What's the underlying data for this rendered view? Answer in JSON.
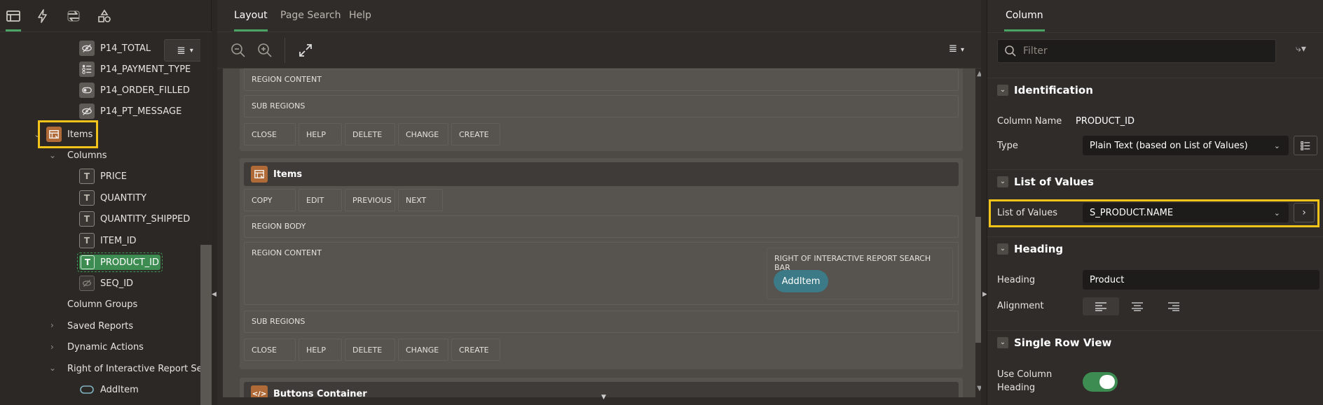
{
  "left_panel": {
    "tabs": [
      "rendering-tab",
      "dynamic-actions-tab",
      "processing-tab",
      "shared-components-tab"
    ],
    "tree": {
      "items_above": [
        {
          "label": "P14_TOTAL",
          "icon": "hidden-item-icon"
        },
        {
          "label": "P14_PAYMENT_TYPE",
          "icon": "radio-group-icon"
        },
        {
          "label": "P14_ORDER_FILLED",
          "icon": "switch-item-icon"
        },
        {
          "label": "P14_PT_MESSAGE",
          "icon": "hidden-item-icon"
        }
      ],
      "region": {
        "label": "Items"
      },
      "columns_group": {
        "label": "Columns"
      },
      "columns": [
        {
          "label": "PRICE"
        },
        {
          "label": "QUANTITY"
        },
        {
          "label": "QUANTITY_SHIPPED"
        },
        {
          "label": "ITEM_ID"
        },
        {
          "label": "PRODUCT_ID"
        },
        {
          "label": "SEQ_ID"
        }
      ],
      "column_groups": "Column Groups",
      "saved_reports": "Saved Reports",
      "dynamic_actions": "Dynamic Actions",
      "right_of_ir": "Right of Interactive Report Search",
      "add_item": "AddItem"
    }
  },
  "center_panel": {
    "tabs": [
      "Layout",
      "Page Search",
      "Help"
    ],
    "active_tab": "Layout",
    "top_region": {
      "region_content": "REGION CONTENT",
      "sub_regions": "SUB REGIONS",
      "buttons": [
        "CLOSE",
        "HELP",
        "DELETE",
        "CHANGE",
        "CREATE"
      ]
    },
    "items_region": {
      "title": "Items",
      "top_buttons": [
        "COPY",
        "EDIT",
        "PREVIOUS",
        "NEXT"
      ],
      "region_body": "REGION BODY",
      "region_content": "REGION CONTENT",
      "right_of_search": "RIGHT OF INTERACTIVE REPORT SEARCH BAR",
      "add_item_button": "AddItem",
      "sub_regions": "SUB REGIONS",
      "bottom_buttons": [
        "CLOSE",
        "HELP",
        "DELETE",
        "CHANGE",
        "CREATE"
      ]
    },
    "next_region_partial": "Buttons Container"
  },
  "right_panel": {
    "tab": "Column",
    "filter_placeholder": "Filter",
    "sections": {
      "identification": "Identification",
      "list_of_values": "List of Values",
      "heading": "Heading",
      "single_row_view": "Single Row View"
    },
    "props": {
      "column_name_label": "Column Name",
      "column_name_value": "PRODUCT_ID",
      "type_label": "Type",
      "type_value": "Plain Text (based on List of Values)",
      "lov_label": "List of Values",
      "lov_value": "S_PRODUCT.NAME",
      "heading_label": "Heading",
      "heading_value": "Product",
      "alignment_label": "Alignment",
      "use_col_heading_label_1": "Use Column",
      "use_col_heading_label_2": "Heading",
      "use_col_heading_value": true
    }
  },
  "colors": {
    "accent_green": "#4aa564",
    "highlight_yellow": "#f2c318",
    "region_icon": "#b06a37",
    "add_button": "#3b7a86"
  }
}
